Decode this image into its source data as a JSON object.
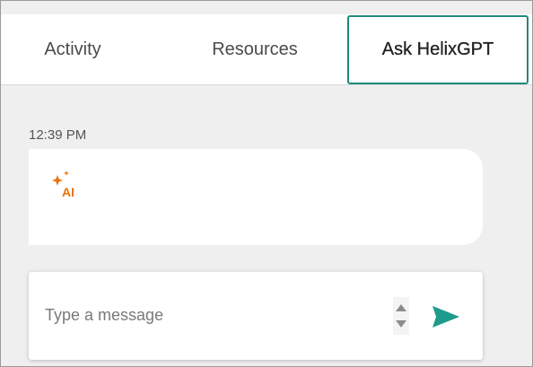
{
  "tabs": [
    {
      "label": "Activity",
      "active": false
    },
    {
      "label": "Resources",
      "active": false
    },
    {
      "label": "Ask HelixGPT",
      "active": true
    }
  ],
  "conversation": {
    "messages": [
      {
        "timestamp": "12:39 PM",
        "sender_badge": "AI",
        "text": ""
      }
    ]
  },
  "composer": {
    "placeholder": "Type a message",
    "value": ""
  },
  "icons": {
    "ai_badge": "sparkle-ai-icon",
    "stepper_up": "chevron-up-icon",
    "stepper_down": "chevron-down-icon",
    "send": "send-icon"
  },
  "colors": {
    "accent": "#1f8a7d",
    "send": "#1e9b8a",
    "ai_badge": "#e8730c"
  }
}
